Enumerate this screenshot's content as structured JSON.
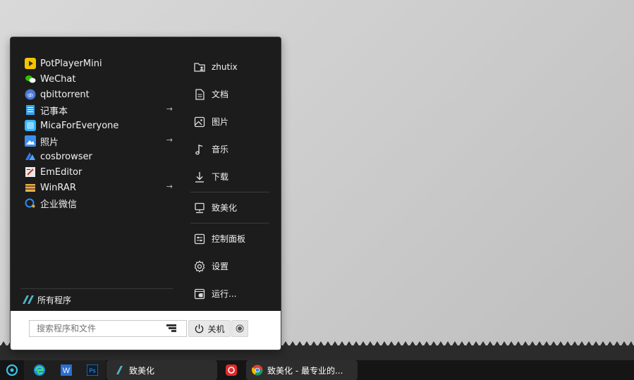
{
  "apps": [
    {
      "label": "PotPlayerMini",
      "icon": "potplayer-icon",
      "color": "#f5c400",
      "has_submenu": false
    },
    {
      "label": "WeChat",
      "icon": "wechat-icon",
      "color": "#2dc100",
      "has_submenu": false
    },
    {
      "label": "qbittorrent",
      "icon": "qbittorrent-icon",
      "color": "#4a7ad6",
      "has_submenu": false
    },
    {
      "label": "记事本",
      "icon": "notepad-icon",
      "color": "#3aa0e8",
      "has_submenu": true
    },
    {
      "label": "MicaForEveryone",
      "icon": "mica-icon",
      "color": "#35b6ff",
      "has_submenu": false
    },
    {
      "label": "照片",
      "icon": "photos-icon",
      "color": "#3b8ef0",
      "has_submenu": true
    },
    {
      "label": "cosbrowser",
      "icon": "cosbrowser-icon",
      "color": "#2f7bf6",
      "has_submenu": false
    },
    {
      "label": "EmEditor",
      "icon": "emeditor-icon",
      "color": "#e9e9e9",
      "has_submenu": false
    },
    {
      "label": "WinRAR",
      "icon": "winrar-icon",
      "color": "#e2b24a",
      "has_submenu": true
    },
    {
      "label": "企业微信",
      "icon": "wecom-icon",
      "color": "#2d8cf0",
      "has_submenu": false
    }
  ],
  "submenu_arrow": "→",
  "all_programs_label": "所有程序",
  "places": [
    {
      "label": "zhutix",
      "icon": "user-folder-icon"
    },
    {
      "label": "文档",
      "icon": "document-icon"
    },
    {
      "label": "图片",
      "icon": "picture-icon"
    },
    {
      "label": "音乐",
      "icon": "music-icon"
    },
    {
      "label": "下载",
      "icon": "download-icon"
    },
    {
      "label": "致美化",
      "icon": "computer-icon"
    },
    {
      "label": "控制面板",
      "icon": "control-panel-icon"
    },
    {
      "label": "设置",
      "icon": "gear-icon"
    },
    {
      "label": "运行...",
      "icon": "run-icon"
    }
  ],
  "search": {
    "placeholder": "搜索程序和文件"
  },
  "power": {
    "label": "关机"
  },
  "taskbar": {
    "start_icon": "start-orb-icon",
    "pinned": [
      "edge-icon",
      "word-icon",
      "photoshop-icon"
    ],
    "tasks": [
      {
        "label": "致美化",
        "icon": "zhutix-icon"
      },
      {
        "label": "致美化 - 最专业的...",
        "icon": "chrome-icon"
      }
    ],
    "netease_icon": "netease-music-icon"
  }
}
